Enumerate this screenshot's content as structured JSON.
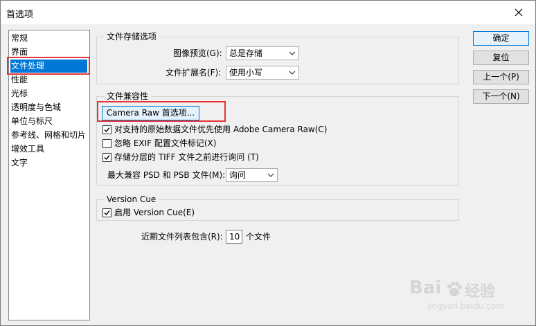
{
  "window": {
    "title": "首选项"
  },
  "sidebar": {
    "items": [
      {
        "label": "常规"
      },
      {
        "label": "界面"
      },
      {
        "label": "文件处理",
        "selected": true
      },
      {
        "label": "性能"
      },
      {
        "label": "光标"
      },
      {
        "label": "透明度与色域"
      },
      {
        "label": "单位与标尺"
      },
      {
        "label": "参考线、网格和切片"
      },
      {
        "label": "增效工具"
      },
      {
        "label": "文字"
      }
    ]
  },
  "file_save": {
    "legend": "文件存储选项",
    "image_preview_label": "图像预览(G):",
    "image_preview_value": "总是存储",
    "extension_label": "文件扩展名(F):",
    "extension_value": "使用小写"
  },
  "compat": {
    "legend": "文件兼容性",
    "camera_raw_button": "Camera Raw 首选项...",
    "opt_acr": {
      "label": "对支持的原始数据文件优先使用 Adobe Camera Raw(C)",
      "checked": true
    },
    "opt_exif": {
      "label": "忽略 EXIF 配置文件标记(X)",
      "checked": false
    },
    "opt_tiff": {
      "label": "存储分层的 TIFF 文件之前进行询问 (T)",
      "checked": true
    },
    "max_compat_label": "最大兼容 PSD 和 PSB 文件(M):",
    "max_compat_value": "询问"
  },
  "version_cue": {
    "legend": "Version Cue",
    "enable": {
      "label": "启用 Version Cue(E)",
      "checked": true
    }
  },
  "recent": {
    "label": "近期文件列表包含(R):",
    "value": "10",
    "suffix": "个文件"
  },
  "buttons": {
    "ok": "确定",
    "reset": "复位",
    "prev": "上一个(P)",
    "next": "下一个(N)"
  },
  "watermark": {
    "brand": "Bai",
    "brand_suffix": "经验",
    "url": "jingyan.baidu.com"
  },
  "colors": {
    "selection": "#0078d7",
    "highlight_box": "#e43434"
  }
}
